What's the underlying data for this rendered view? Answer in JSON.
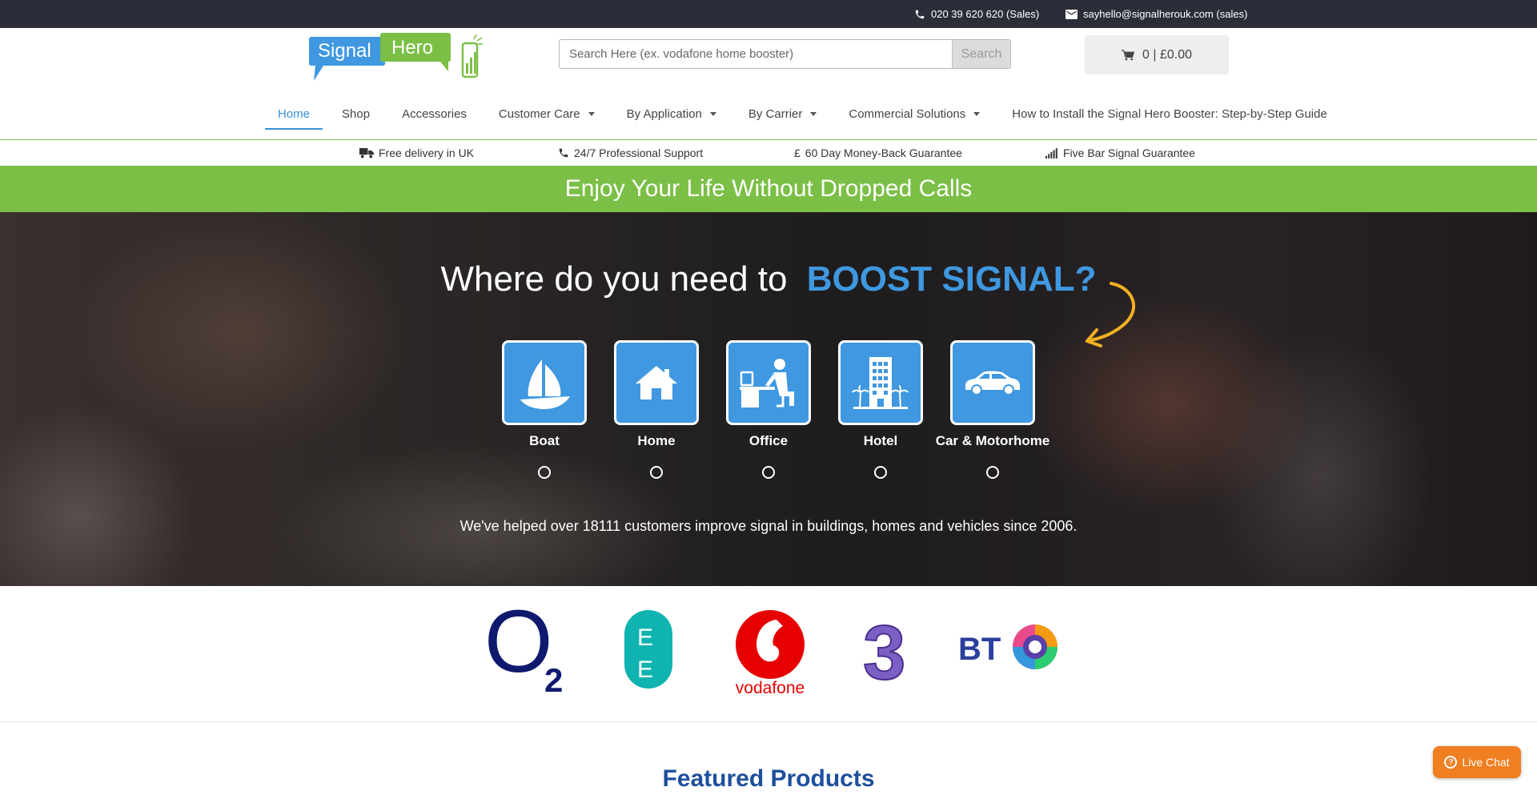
{
  "topbar": {
    "phone": "020 39 620 620 (Sales)",
    "email": "sayhello@signalherouk.com  (sales)"
  },
  "logo": {
    "word1": "Signal",
    "word2": "Hero"
  },
  "search": {
    "placeholder": "Search Here (ex. vodafone home booster)",
    "button_label": "Search"
  },
  "cart": {
    "summary": "0 | £0.00"
  },
  "nav": {
    "items": [
      {
        "label": "Home",
        "active": true,
        "dropdown": false
      },
      {
        "label": "Shop",
        "dropdown": false
      },
      {
        "label": "Accessories",
        "dropdown": false
      },
      {
        "label": "Customer Care",
        "dropdown": true
      },
      {
        "label": "By Application",
        "dropdown": true
      },
      {
        "label": "By Carrier",
        "dropdown": true
      },
      {
        "label": "Commercial Solutions",
        "dropdown": true
      },
      {
        "label": "How to Install the Signal Hero Booster: Step-by-Step Guide",
        "dropdown": false
      }
    ]
  },
  "benefits": [
    {
      "label": "Free delivery in UK",
      "icon": "truck-icon"
    },
    {
      "label": "24/7 Professional Support",
      "icon": "phone-icon"
    },
    {
      "label": "60 Day Money-Back Guarantee",
      "icon": "pound-icon",
      "prefix": "£"
    },
    {
      "label": "Five Bar Signal Guarantee",
      "icon": "signal-bars-icon"
    }
  ],
  "banner": {
    "text": "Enjoy Your Life Without Dropped Calls"
  },
  "hero": {
    "title": "Where do you need to",
    "title_accent": "BOOST SIGNAL?",
    "applications": [
      {
        "label": "Boat",
        "icon": "sailboat-icon"
      },
      {
        "label": "Home",
        "icon": "house-icon"
      },
      {
        "label": "Office",
        "icon": "office-worker-icon"
      },
      {
        "label": "Hotel",
        "icon": "hotel-building-icon"
      },
      {
        "label": "Car & Motorhome",
        "icon": "car-icon"
      }
    ],
    "subtitle": "We've helped over 18111 customers improve signal in buildings, homes and vehicles since 2006."
  },
  "carriers": [
    {
      "name": "O2",
      "logo_text": "O",
      "logo_sub": "2",
      "color": "#0f1a6e"
    },
    {
      "name": "EE",
      "logo_text": "E E",
      "color": "#0fb3b0"
    },
    {
      "name": "Vodafone",
      "logo_text": "vodafone",
      "color": "#e60000"
    },
    {
      "name": "Three",
      "logo_text": "3",
      "color": "#6b4fb3"
    },
    {
      "name": "BT",
      "logo_text": "BT",
      "color": "#2a3f9e"
    }
  ],
  "featured": {
    "title": "Featured Products"
  },
  "live_chat": {
    "label": "Live Chat"
  },
  "colors": {
    "accent_blue": "#3f98e0",
    "brand_green": "#7bbf46",
    "dark_bar": "#2b2e38",
    "chat_orange": "#f07f22"
  }
}
